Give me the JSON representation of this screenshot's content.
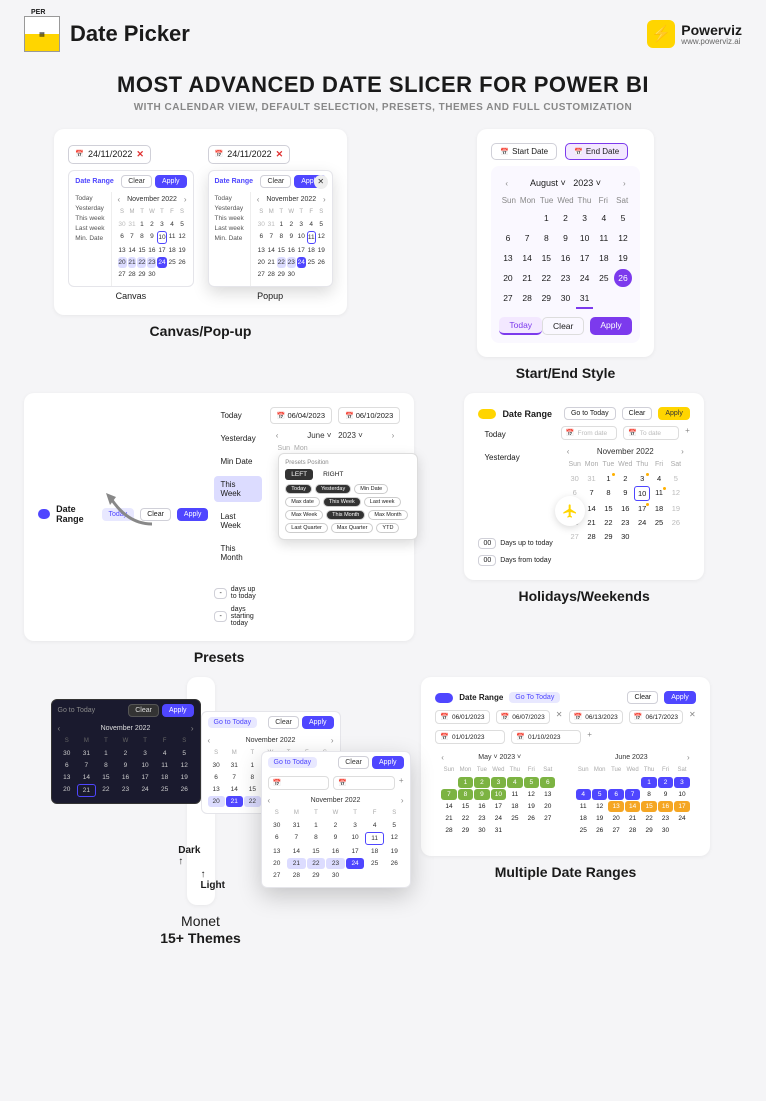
{
  "header": {
    "title": "Date Picker",
    "brand": "Powerviz",
    "brand_url": "www.powerviz.ai"
  },
  "hero": {
    "headline": "MOST ADVANCED DATE SLICER FOR POWER BI",
    "subhead": "WITH CALENDAR VIEW, DEFAULT SELECTION, PRESETS, THEMES AND FULL CUSTOMIZATION"
  },
  "cards": {
    "canvas_popup": {
      "title": "Canvas/Pop-up",
      "canvas_label": "Canvas",
      "popup_label": "Popup",
      "date_chip": "24/11/2022",
      "panel": {
        "range_label": "Date Range",
        "clear": "Clear",
        "apply": "Apply",
        "month": "November 2022",
        "presets": [
          "Today",
          "Yesterday",
          "This week",
          "Last week",
          "Min. Date"
        ],
        "dow": [
          "S",
          "M",
          "T",
          "W",
          "T",
          "F",
          "S"
        ]
      }
    },
    "startend": {
      "title": "Start/End Style",
      "start": "Start Date",
      "end": "End Date",
      "month": "August",
      "year": "2023",
      "dow": [
        "Sun",
        "Mon",
        "Tue",
        "Wed",
        "Thu",
        "Fri",
        "Sat"
      ],
      "today_btn": "Today",
      "clear_btn": "Clear",
      "apply_btn": "Apply",
      "today_cell": "31",
      "sel_cell": "26"
    },
    "presets": {
      "title": "Presets",
      "range_label": "Date Range",
      "today_btn": "Today",
      "clear": "Clear",
      "apply": "Apply",
      "date1": "06/04/2023",
      "date2": "06/10/2023",
      "month": "June",
      "year": "2023",
      "side": [
        "Today",
        "Yesterday",
        "Min Date",
        "This Week",
        "Last Week",
        "This Month"
      ],
      "days_up": "days up to today",
      "days_from": "days starting today",
      "pop_title": "Presets Position",
      "pop_tabs": [
        "LEFT",
        "RIGHT"
      ],
      "chips": [
        "Today",
        "Yesterday",
        "Min Date",
        "Max date",
        "This Week",
        "Last week",
        "Max Week",
        "This Month",
        "Max Month",
        "Last Quarter",
        "Max Quarter",
        "YTD"
      ]
    },
    "holidays": {
      "title": "Holidays/Weekends",
      "range_label": "Date Range",
      "goto": "Go to Today",
      "clear": "Clear",
      "apply": "Apply",
      "from": "From date",
      "to": "To date",
      "month": "November 2022",
      "dow": [
        "Sun",
        "Mon",
        "Tue",
        "Wed",
        "Thu",
        "Fri",
        "Sat"
      ],
      "days_up": "Days up to today",
      "days_from": "Days from today",
      "today_cell": "10",
      "count": "00"
    },
    "themes": {
      "title_line1": "Monet",
      "title_line2": "15+ Themes",
      "light": "Light",
      "dark": "Dark",
      "goto": "Go to Today",
      "clear": "Clear",
      "apply": "Apply",
      "month": "November 2022"
    },
    "multirange": {
      "title": "Multiple Date Ranges",
      "range_label": "Date Range",
      "goto": "Go To Today",
      "clear": "Clear",
      "apply": "Apply",
      "dates": [
        "06/01/2023",
        "06/07/2023",
        "06/13/2023",
        "06/17/2023",
        "01/01/2023",
        "01/10/2023"
      ],
      "month1": "May",
      "year1": "2023",
      "month2": "June 2023",
      "dow": [
        "Sun",
        "Mon",
        "Tue",
        "Wed",
        "Thu",
        "Fri",
        "Sat"
      ]
    }
  }
}
